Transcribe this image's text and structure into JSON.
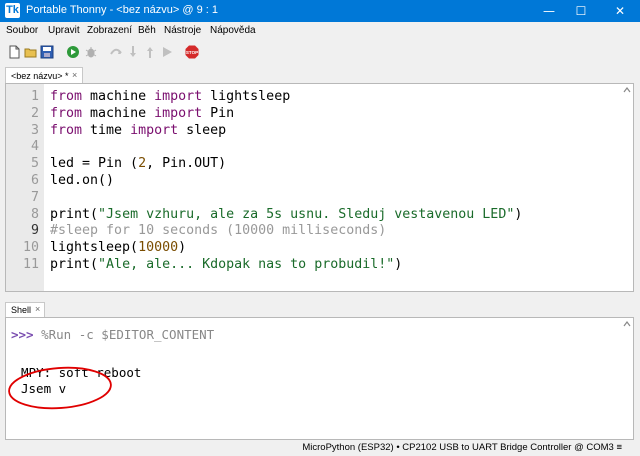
{
  "window": {
    "app_icon_glyph": "Tk",
    "title": "Portable Thonny  -  <bez názvu>  @  9 : 1",
    "minimize_glyph": "—",
    "maximize_glyph": "☐",
    "close_glyph": "✕"
  },
  "menu": [
    "Soubor",
    "Upravit",
    "Zobrazení",
    "Běh",
    "Nástroje",
    "Nápověda"
  ],
  "toolbar": {
    "icons": [
      "new-file-icon",
      "open-file-icon",
      "save-icon",
      "run-icon",
      "debug-icon",
      "step-over-icon",
      "step-into-icon",
      "step-out-icon",
      "resume-icon",
      "stop-icon"
    ],
    "stop_label": "STOP"
  },
  "editor": {
    "tab_label": "<bez názvu> *",
    "tab_close": "×",
    "line_numbers": [
      "1",
      "2",
      "3",
      "4",
      "5",
      "6",
      "7",
      "8",
      "9",
      "10",
      "11"
    ],
    "lines": [
      "from machine import lightsleep",
      "from machine import Pin",
      "from time import sleep",
      "",
      "led = Pin (2, Pin.OUT)",
      "led.on()",
      "",
      "print(\"Jsem vzhuru, ale za 5s usnu. Sleduj vestavenou LED\")",
      "#sleep for 10 seconds (10000 milliseconds)",
      "lightsleep(10000)",
      "print(\"Ale, ale... Kdopak nas to probudil!\")"
    ],
    "active_line": "9"
  },
  "shell": {
    "tab_label": "Shell",
    "tab_close": "×",
    "prompt": ">>>",
    "command": " %Run -c $EDITOR_CONTENT",
    "output": [
      "MPY: soft reboot",
      "Jsem v"
    ],
    "annotation_color": "#e00000"
  },
  "status": {
    "interpreter": "MicroPython (ESP32)  •  CP2102 USB to UART Bridge Controller @ COM3  ≡"
  }
}
